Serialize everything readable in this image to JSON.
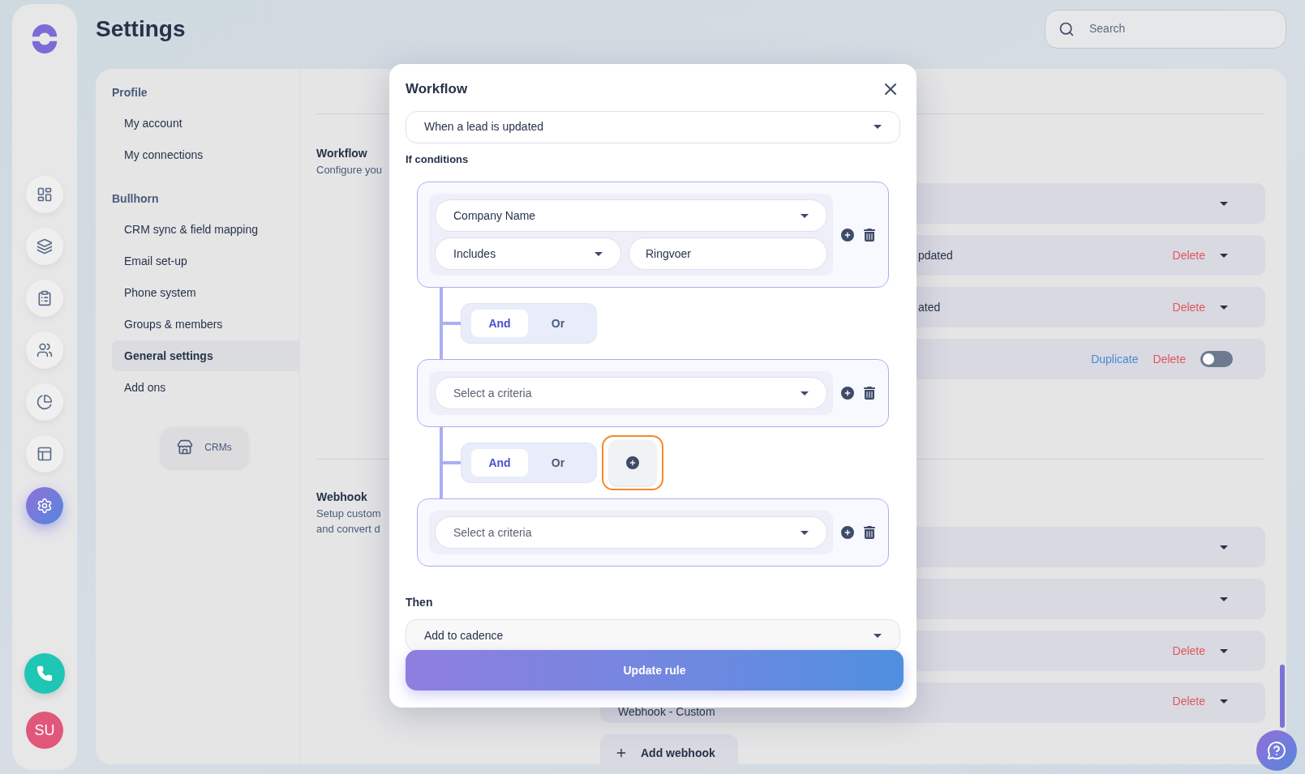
{
  "rail": {
    "items": [
      {
        "kind": "dashboard",
        "selected": false
      },
      {
        "kind": "inbox",
        "selected": false
      },
      {
        "kind": "tasks",
        "selected": false
      },
      {
        "kind": "team",
        "selected": false
      },
      {
        "kind": "reports",
        "selected": false
      },
      {
        "kind": "layout",
        "selected": false
      },
      {
        "kind": "settings",
        "selected": true
      }
    ],
    "avatar": "SU"
  },
  "header": {
    "title": "Settings",
    "search": {
      "placeholder": "Search"
    }
  },
  "nav": {
    "sections": [
      {
        "heading": "Profile",
        "items": [
          {
            "label": "My account",
            "selected": false
          },
          {
            "label": "My connections",
            "selected": false
          }
        ]
      },
      {
        "heading": "Bullhorn",
        "items": [
          {
            "label": "CRM sync & field mapping",
            "selected": false
          },
          {
            "label": "Email set-up",
            "selected": false
          },
          {
            "label": "Phone system",
            "selected": false
          },
          {
            "label": "Groups & members",
            "selected": false
          },
          {
            "label": "General settings",
            "selected": true
          },
          {
            "label": "Add ons",
            "selected": false
          }
        ]
      }
    ],
    "crm_button": "CRMs"
  },
  "content": {
    "sections": [
      {
        "title": "Workflow",
        "description": [
          "Configure you"
        ],
        "rows": [
          {
            "kind": "select"
          },
          {
            "kind": "select",
            "text": "pdated",
            "delete": "Delete"
          },
          {
            "kind": "select",
            "text": "ated",
            "delete": "Delete"
          },
          {
            "kind": "toggle",
            "duplicate": "Duplicate",
            "delete": "Delete",
            "on": false
          }
        ]
      },
      {
        "title": "Webhook",
        "description": [
          "Setup custom",
          "and convert d"
        ],
        "rows": [
          {
            "kind": "select"
          },
          {
            "kind": "select"
          },
          {
            "kind": "select",
            "delete": "Delete"
          },
          {
            "kind": "select",
            "text": "Webhook - Custom",
            "delete": "Delete"
          }
        ],
        "add_button": "Add webhook"
      }
    ]
  },
  "modal": {
    "title": "Workflow",
    "trigger": "When a lead is updated",
    "conditions_label": "If conditions",
    "groups": [
      {
        "criteria": "Company Name",
        "operator": "Includes",
        "value": "Ringvoer"
      },
      {
        "criteria_placeholder": "Select a criteria"
      },
      {
        "criteria_placeholder": "Select a criteria"
      }
    ],
    "connectors": [
      {
        "options": [
          {
            "label": "And",
            "selected": true
          },
          {
            "label": "Or",
            "selected": false
          }
        ],
        "add_button": false
      },
      {
        "options": [
          {
            "label": "And",
            "selected": true
          },
          {
            "label": "Or",
            "selected": false
          }
        ],
        "add_button": true
      }
    ],
    "then_label": "Then",
    "action": "Add to cadence",
    "submit": "Update rule"
  }
}
